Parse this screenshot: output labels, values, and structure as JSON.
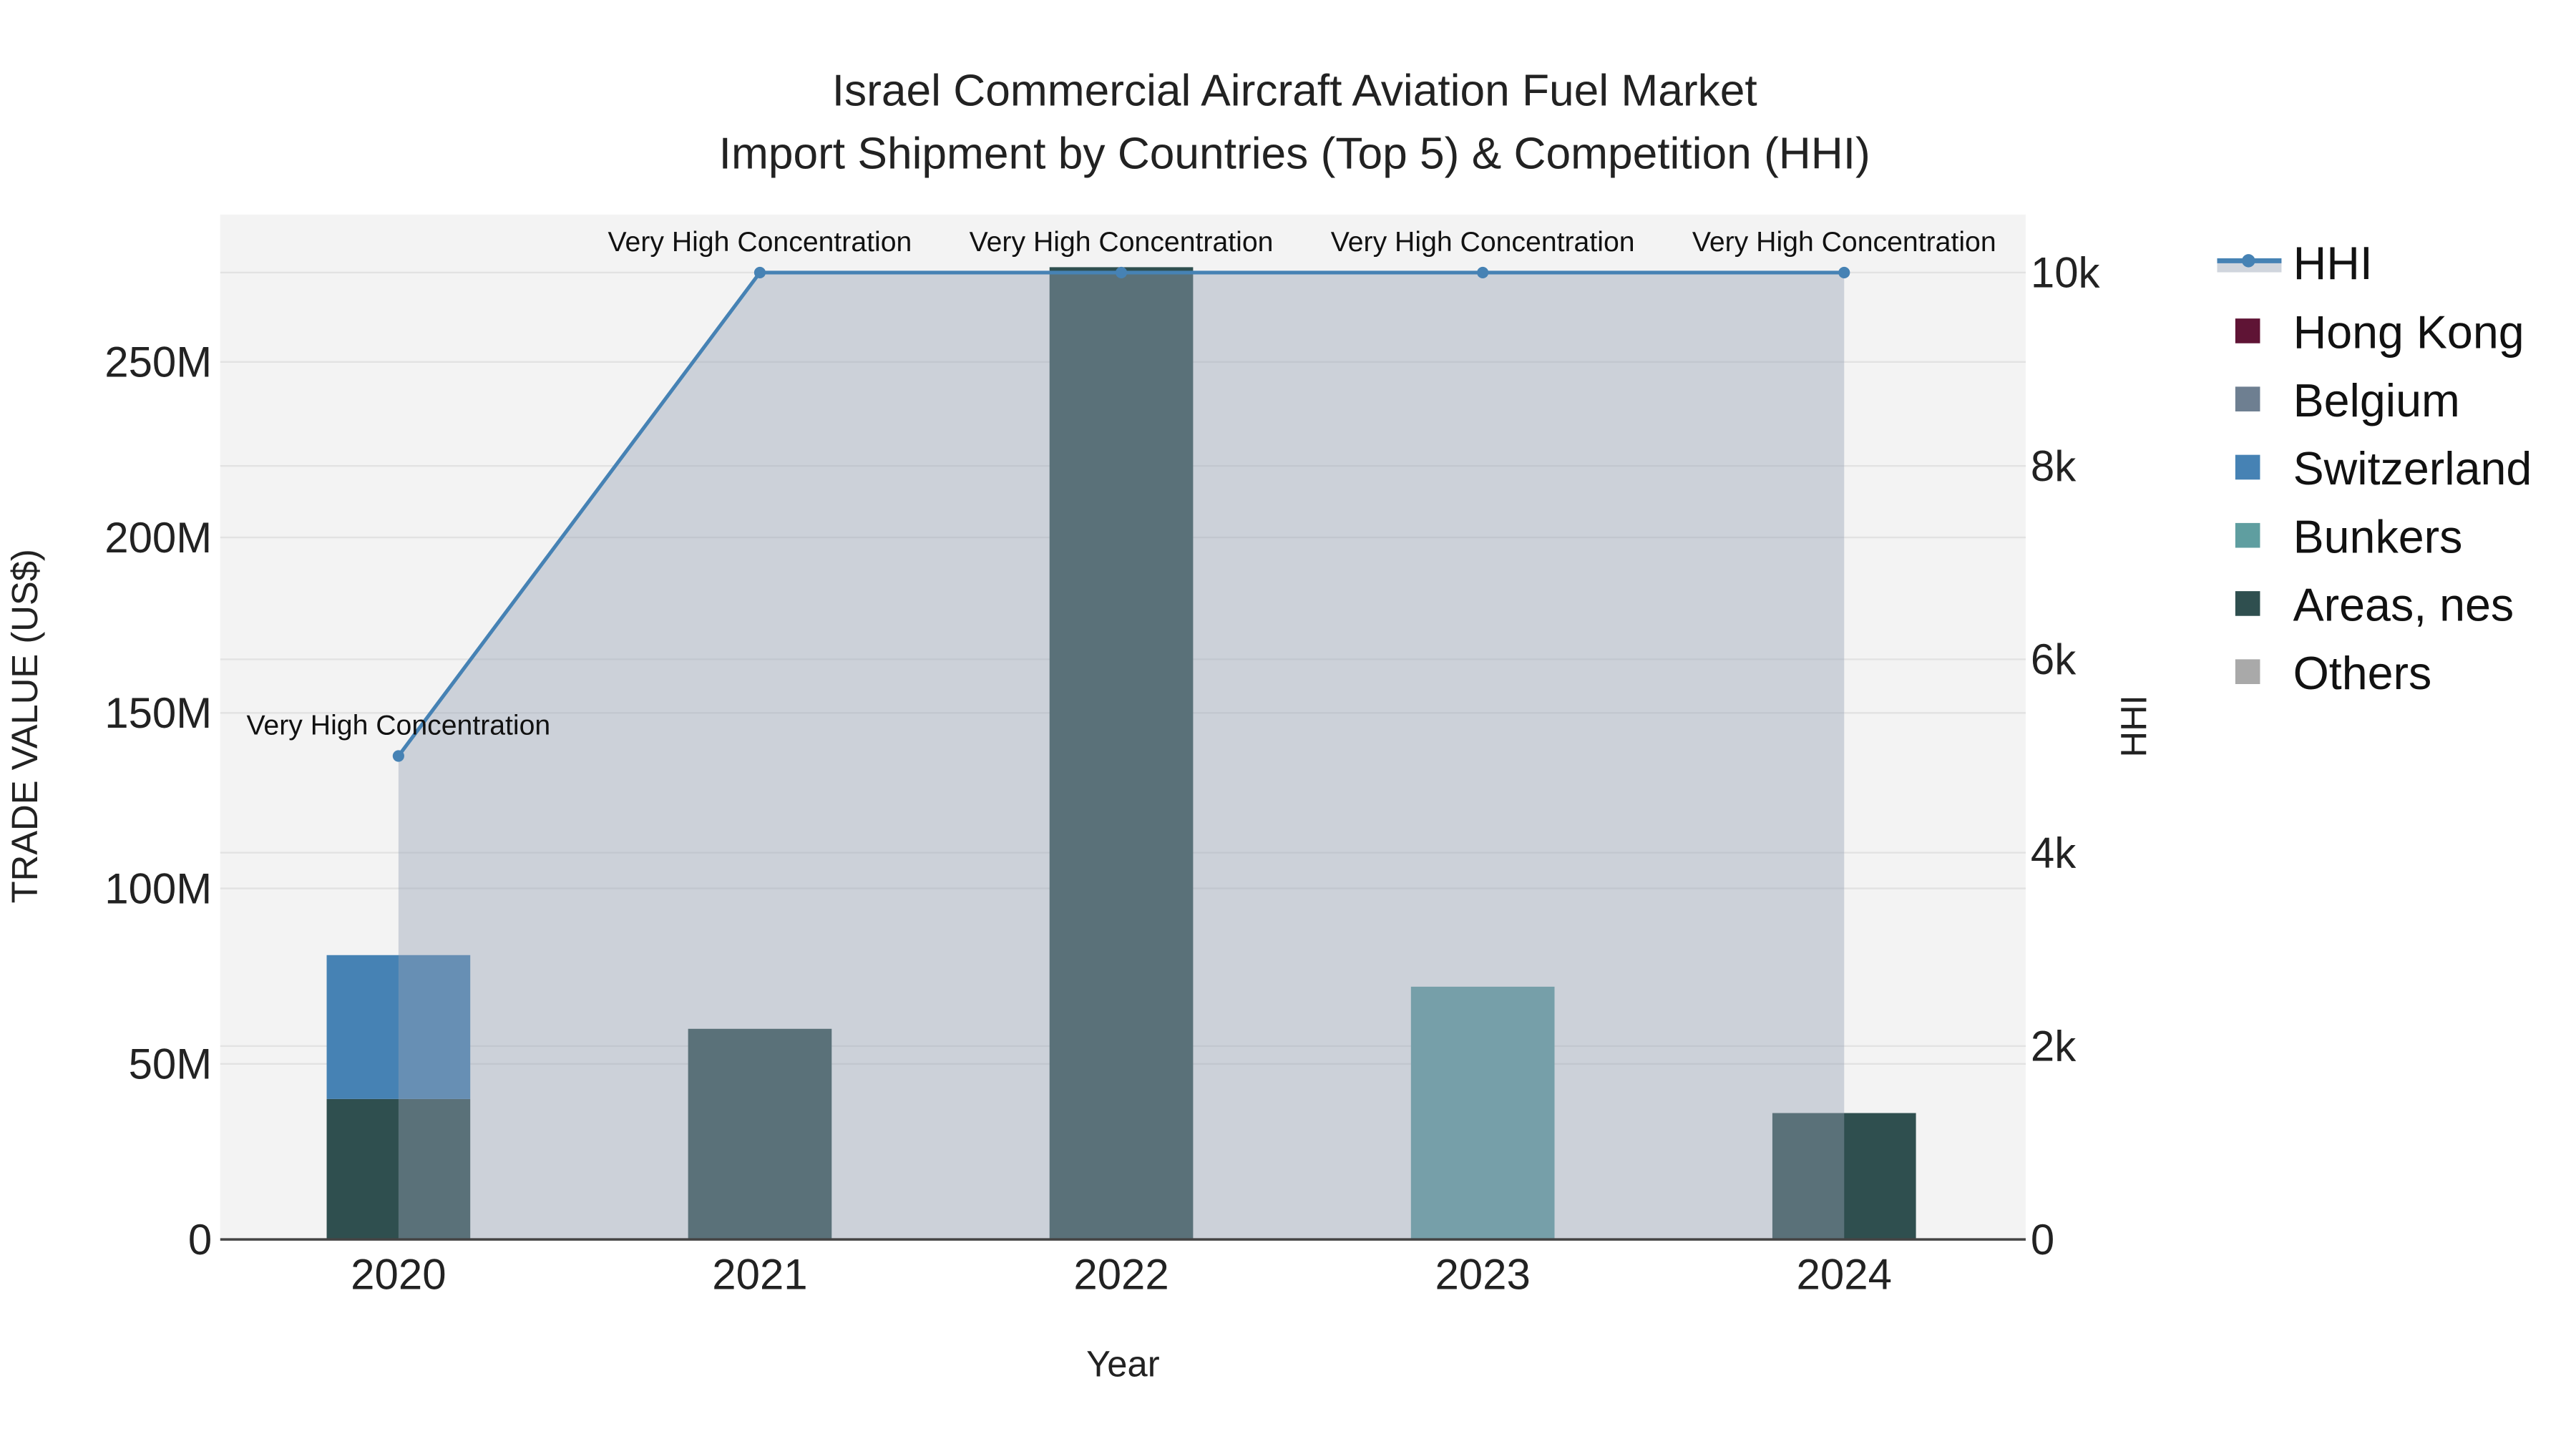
{
  "chart_data": {
    "type": "bar",
    "title_line1": "Israel Commercial Aircraft Aviation Fuel Market",
    "title_line2": "Import Shipment by Countries (Top 5) & Competition (HHI)",
    "xlabel": "Year",
    "ylabel": "TRADE VALUE (US$)",
    "y2label": "HHI",
    "categories": [
      "2020",
      "2021",
      "2022",
      "2023",
      "2024"
    ],
    "ylim": [
      0,
      292
    ],
    "y_unit": "M",
    "y_ticks": [
      0,
      50,
      100,
      150,
      200,
      250
    ],
    "y_tick_labels": [
      "0",
      "50M",
      "100M",
      "150M",
      "200M",
      "250M"
    ],
    "y2lim": [
      0,
      10600
    ],
    "y2_ticks": [
      0,
      2000,
      4000,
      6000,
      8000,
      10000
    ],
    "y2_tick_labels": [
      "0",
      "2k",
      "4k",
      "6k",
      "8k",
      "10k"
    ],
    "series": [
      {
        "name": "Hong Kong",
        "color": "#5f1435",
        "values": [
          0,
          0,
          0,
          0,
          0
        ]
      },
      {
        "name": "Belgium",
        "color": "#6e7f91",
        "values": [
          0,
          0,
          0,
          0,
          0
        ]
      },
      {
        "name": "Switzerland",
        "color": "#4682b4",
        "values": [
          41,
          0,
          0,
          0,
          0
        ]
      },
      {
        "name": "Bunkers",
        "color": "#5f9ea0",
        "values": [
          0,
          0,
          0,
          72,
          0
        ]
      },
      {
        "name": "Areas, nes",
        "color": "#2f4f4f",
        "values": [
          40,
          60,
          277,
          0,
          36
        ]
      },
      {
        "name": "Others",
        "color": "#a9a9a9",
        "values": [
          0,
          0,
          0,
          0,
          0
        ]
      }
    ],
    "stack_order": [
      "Areas, nes",
      "Bunkers",
      "Switzerland",
      "Belgium",
      "Hong Kong",
      "Others"
    ],
    "hhi": {
      "name": "HHI",
      "color": "#4682b4",
      "values": [
        5000,
        10000,
        10000,
        10000,
        10000
      ],
      "labels": [
        "Very High Concentration",
        "Very High Concentration",
        "Very High Concentration",
        "Very High Concentration",
        "Very High Concentration"
      ]
    },
    "legend_placement": "right",
    "grid": true
  }
}
